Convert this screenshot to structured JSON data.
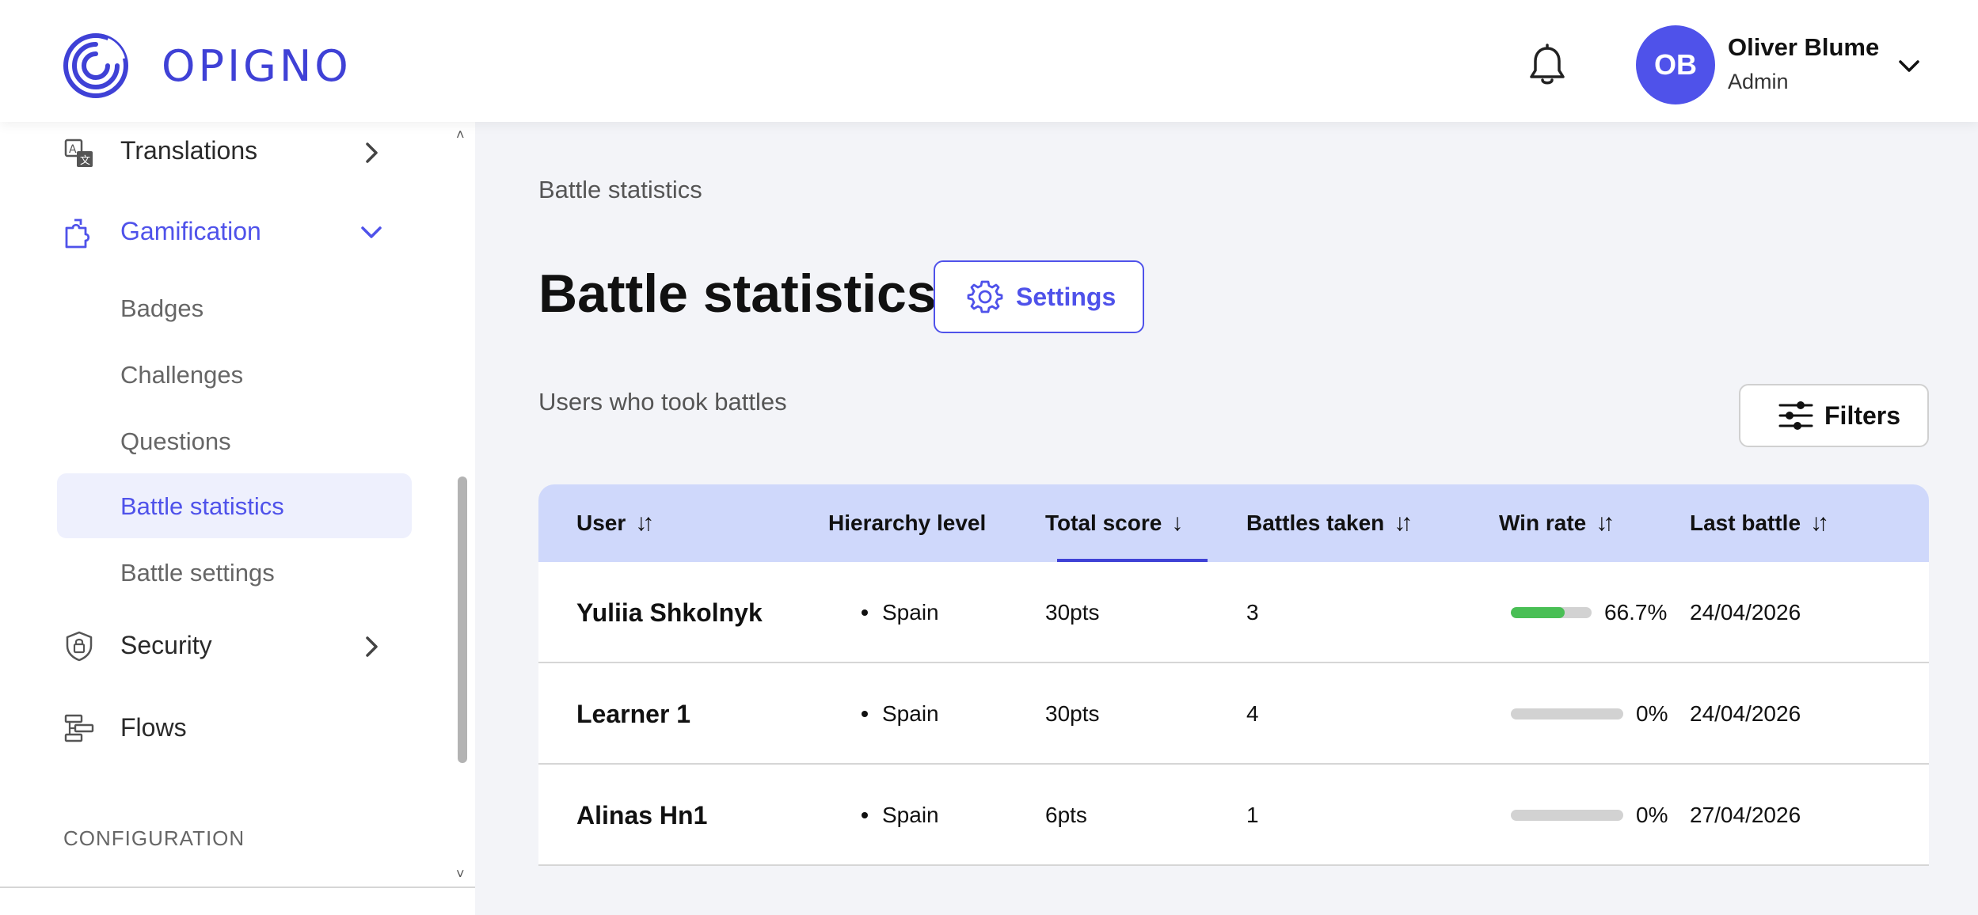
{
  "brand": {
    "name": "OPIGNO",
    "accent": "#3f41d6"
  },
  "header": {
    "user": {
      "initials": "OB",
      "name": "Oliver Blume",
      "role": "Admin"
    }
  },
  "sidebar": {
    "items": [
      {
        "label": "Translations",
        "icon": "translate-icon",
        "expanded": false
      },
      {
        "label": "Gamification",
        "icon": "puzzle-icon",
        "expanded": true,
        "active": true
      },
      {
        "label": "Security",
        "icon": "shield-lock-icon",
        "expanded": false
      },
      {
        "label": "Flows",
        "icon": "flows-icon"
      }
    ],
    "gamification_sub": [
      "Badges",
      "Challenges",
      "Questions",
      "Battle statistics",
      "Battle settings"
    ],
    "active_sub": "Battle statistics",
    "section_header": "CONFIGURATION"
  },
  "main": {
    "breadcrumb": "Battle statistics",
    "title": "Battle statistics",
    "settings_label": "Settings",
    "subtitle": "Users who took battles",
    "filters_label": "Filters",
    "table": {
      "columns": [
        "User",
        "Hierarchy level",
        "Total score",
        "Battles taken",
        "Win rate",
        "Last battle"
      ],
      "sorted_column": "Total score",
      "rows": [
        {
          "user": "Yuliia Shkolnyk",
          "hierarchy": "Spain",
          "score": "30pts",
          "battles": "3",
          "win_rate": "66.7%",
          "win_fraction": 0.667,
          "last_battle": "24/04/2026"
        },
        {
          "user": "Learner 1",
          "hierarchy": "Spain",
          "score": "30pts",
          "battles": "4",
          "win_rate": "0%",
          "win_fraction": 0,
          "last_battle": "24/04/2026"
        },
        {
          "user": "Alinas Hn1",
          "hierarchy": "Spain",
          "score": "6pts",
          "battles": "1",
          "win_rate": "0%",
          "win_fraction": 0,
          "last_battle": "27/04/2026"
        }
      ]
    }
  }
}
